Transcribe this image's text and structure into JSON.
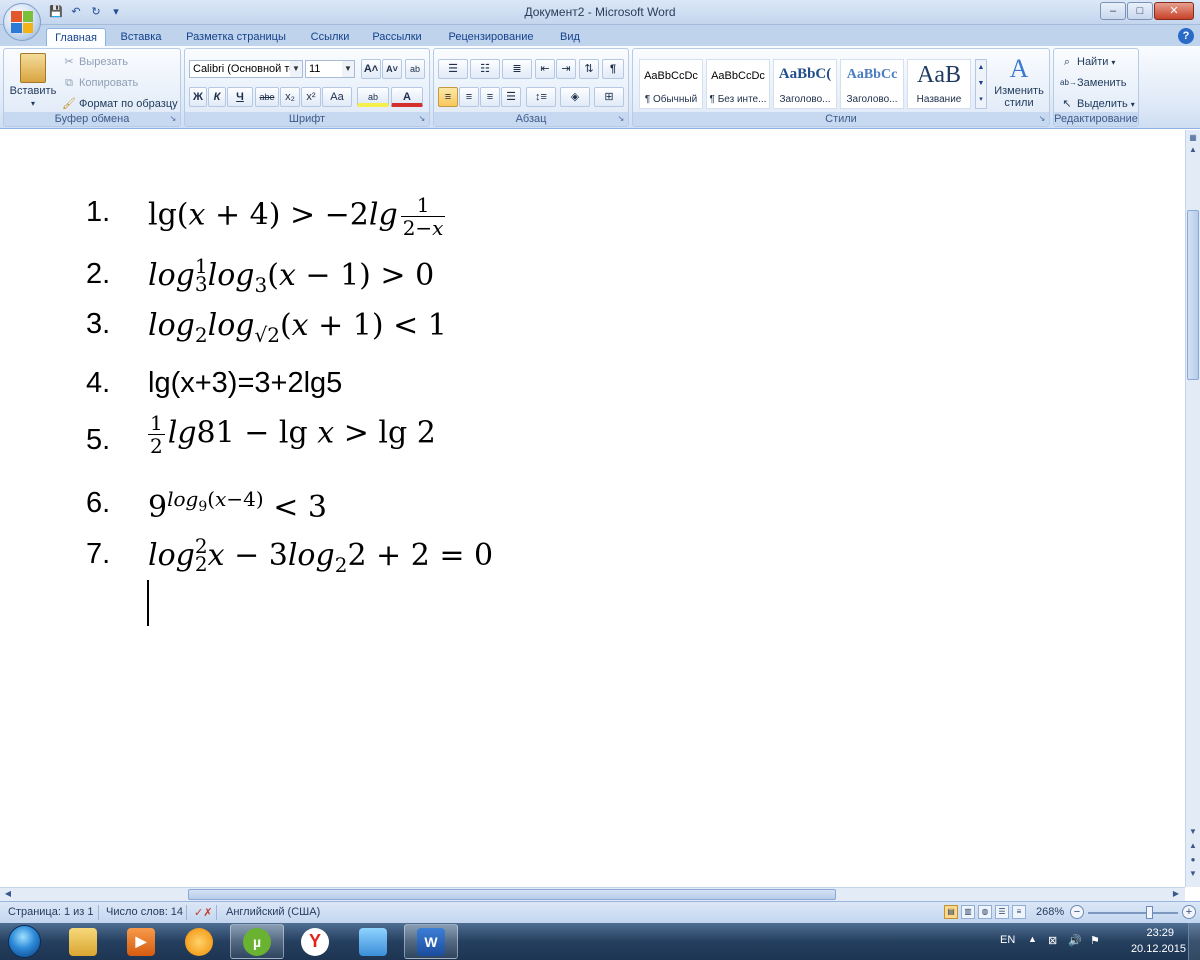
{
  "window": {
    "title": "Документ2 - Microsoft Word",
    "controls": {
      "minimize": "–",
      "maximize": "□",
      "close": "✕"
    }
  },
  "quick_access": {
    "save_icon": "💾",
    "undo_icon": "↶",
    "redo_icon": "↻",
    "customize_icon": "▾"
  },
  "tabs": [
    {
      "label": "Главная"
    },
    {
      "label": "Вставка"
    },
    {
      "label": "Разметка страницы"
    },
    {
      "label": "Ссылки"
    },
    {
      "label": "Рассылки"
    },
    {
      "label": "Рецензирование"
    },
    {
      "label": "Вид"
    }
  ],
  "ribbon": {
    "clipboard": {
      "paste": "Вставить",
      "cut": "Вырезать",
      "copy": "Копировать",
      "format_painter": "Формат по образцу",
      "label": "Буфер обмена"
    },
    "font": {
      "font_name": "Calibri (Основной те",
      "font_size": "11",
      "grow": "A˄",
      "shrink": "A˅",
      "clear": "ab",
      "bold": "Ж",
      "italic": "К",
      "underline": "Ч",
      "strike": "abe",
      "subscript": "x₂",
      "superscript": "x²",
      "case": "Аа",
      "highlight": "ab",
      "font_color": "A",
      "label": "Шрифт"
    },
    "paragraph": {
      "label": "Абзац",
      "show_marks": "¶"
    },
    "styles": {
      "label": "Стили",
      "items": [
        {
          "sample": "AaBbCcDc",
          "name": "¶ Обычный"
        },
        {
          "sample": "AaBbCcDc",
          "name": "¶ Без инте..."
        },
        {
          "sample": "AaBbC(",
          "name": "Заголово..."
        },
        {
          "sample": "AaBbCc",
          "name": "Заголово..."
        },
        {
          "sample": "AaB",
          "name": "Название"
        }
      ],
      "change_styles": "Изменить стили"
    },
    "editing": {
      "find": "Найти",
      "replace": "Заменить",
      "select": "Выделить",
      "label": "Редактирование"
    }
  },
  "document": {
    "numbers": [
      "1.",
      "2.",
      "3.",
      "4.",
      "5.",
      "6.",
      "7."
    ],
    "eq4": "lg(x+3)=3+2lg5"
  },
  "statusbar": {
    "page": "Страница: 1 из 1",
    "words": "Число слов: 14",
    "language": "Английский (США)",
    "zoom": "268%"
  },
  "taskbar": {
    "lang": "EN",
    "time": "23:29",
    "date": "20.12.2015"
  }
}
